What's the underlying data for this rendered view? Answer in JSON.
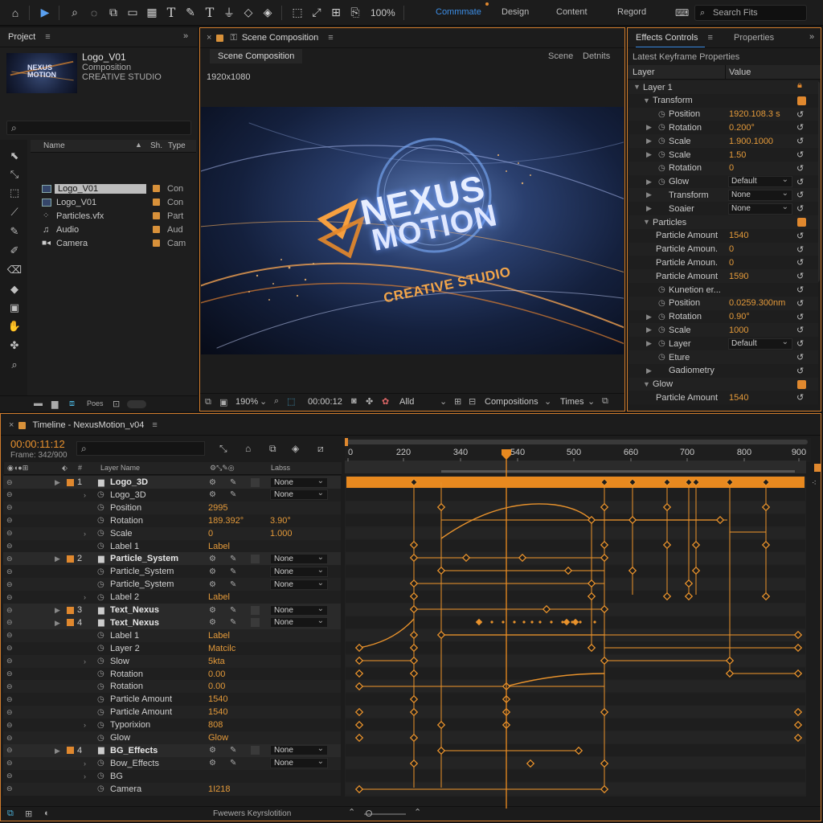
{
  "topbar": {
    "zoom": "100%",
    "workspaces": [
      "Commmate",
      "Design",
      "Content",
      "Regord"
    ],
    "search_placeholder": "Search Fits",
    "accent": "#3d8fe8"
  },
  "project": {
    "tab": "Project",
    "item_name": "Logo_V01",
    "item_type": "Composition",
    "item_studio": "CREATIVE STUDIO",
    "thumb_text": "NEXUS MOTION",
    "col_name": "Name",
    "col_sh": "Sh.",
    "col_type": "Type",
    "rows": [
      {
        "name": "Logo_V01",
        "type": "Con"
      },
      {
        "name": "Logo_V01",
        "type": "Con"
      },
      {
        "name": "Particles.vfx",
        "type": "Part"
      },
      {
        "name": "Audio",
        "type": "Aud"
      },
      {
        "name": "Camera",
        "type": "Cam"
      }
    ],
    "footer_label": "Poes"
  },
  "composition": {
    "tab": "Scene Composition",
    "subtab": "Scene Composition",
    "right_links": [
      "Scene",
      "Detnits"
    ],
    "resolution": "1920x1080",
    "logo_line1": "NEXUS",
    "logo_line2": "MOTION",
    "logo_tagline": "CREATIVE STUDIO",
    "footer": {
      "zoom": "190%",
      "timecode": "00:00:12",
      "mode": "Alld",
      "compositions": "Compositions",
      "times": "Times"
    }
  },
  "effects": {
    "tabs": [
      "Effects Controls",
      "Properties"
    ],
    "subtitle": "Latest Keyframe Properties",
    "col_layer": "Layer",
    "col_value": "Value",
    "rows": [
      {
        "label": "Layer 1",
        "level": 0,
        "kind": "group"
      },
      {
        "label": "Transform",
        "level": 1,
        "kind": "group"
      },
      {
        "label": "Position",
        "level": 2,
        "value": "1920.108.3 s"
      },
      {
        "label": "Rotation",
        "level": 2,
        "value": "0.200°",
        "tw": true
      },
      {
        "label": "Scale",
        "level": 2,
        "value": "1.900.1000",
        "tw": true
      },
      {
        "label": "Scale",
        "level": 2,
        "value": "1.50",
        "tw": true
      },
      {
        "label": "Rotation",
        "level": 2,
        "value": "0"
      },
      {
        "label": "Glow",
        "level": 2,
        "dropdown": "Default",
        "tw": true
      },
      {
        "label": "Transform",
        "level": 2,
        "dropdown": "None",
        "tw": true,
        "nosw": true
      },
      {
        "label": "Soaier",
        "level": 2,
        "dropdown": "None",
        "tw": true,
        "nosw": true
      },
      {
        "label": "Particles",
        "level": 1,
        "kind": "group"
      },
      {
        "label": "Particle Amount",
        "level": 3,
        "value": "1540"
      },
      {
        "label": "Particle Amoun.",
        "level": 3,
        "value": "0"
      },
      {
        "label": "Particle Amoun.",
        "level": 3,
        "value": "0"
      },
      {
        "label": "Particle Amount",
        "level": 3,
        "value": "1590"
      },
      {
        "label": "Kunetion er...",
        "level": 2,
        "value": ""
      },
      {
        "label": "Position",
        "level": 2,
        "value": "0.0259.300nm"
      },
      {
        "label": "Rotation",
        "level": 2,
        "value": "0.90°",
        "tw": true
      },
      {
        "label": "Scale",
        "level": 2,
        "value": "1000",
        "tw": true
      },
      {
        "label": "Layer",
        "level": 2,
        "dropdown": "Default",
        "tw": true
      },
      {
        "label": "Eture",
        "level": 2,
        "value": ""
      },
      {
        "label": "Gadiometry",
        "level": 2,
        "value": "",
        "tw": true,
        "nosw": true
      },
      {
        "label": "Glow",
        "level": 1,
        "kind": "group"
      },
      {
        "label": "Particle Amount",
        "level": 3,
        "value": "1540"
      }
    ]
  },
  "timeline": {
    "tab": "Timeline - NexusMotion_v04",
    "timecode": "00:00:11:12",
    "frame": "Frame: 342/900",
    "col_layer_name": "Layer Name",
    "col_labels": "Labss",
    "ruler": [
      "0",
      "220",
      "340",
      "540",
      "500",
      "660",
      "700",
      "800",
      "900"
    ],
    "footer_label": "Fwewers Keyrslotition",
    "rows": [
      {
        "indent": 0,
        "num": "1",
        "name": "Logo_3D",
        "bold": true,
        "layer": true,
        "dd": "None"
      },
      {
        "indent": 1,
        "name": "Logo_3D",
        "tw": true,
        "dd": "None",
        "icons": true
      },
      {
        "indent": 1,
        "name": "Position",
        "v1": "2995"
      },
      {
        "indent": 1,
        "name": "Rotation",
        "v1": "189.392°",
        "v2": "3.90°"
      },
      {
        "indent": 1,
        "name": "Scale",
        "tw": true,
        "v1": "0",
        "v2": "1.000"
      },
      {
        "indent": 1,
        "name": "Label 1",
        "v1": "Label"
      },
      {
        "indent": 0,
        "num": "2",
        "name": "Particle_System",
        "bold": true,
        "layer": true,
        "dd": "None"
      },
      {
        "indent": 1,
        "name": "Particle_System",
        "dd": "None",
        "icons": true
      },
      {
        "indent": 1,
        "name": "Particle_System",
        "dd": "None",
        "icons": true
      },
      {
        "indent": 1,
        "name": "Label 2",
        "tw": true,
        "v1": "Label"
      },
      {
        "indent": 0,
        "num": "3",
        "name": "Text_Nexus",
        "bold": true,
        "layer": true,
        "dd": "None"
      },
      {
        "indent": 0,
        "num": "4",
        "name": "Text_Nexus",
        "bold": true,
        "layer": true,
        "dd": "None"
      },
      {
        "indent": 1,
        "name": "Label 1",
        "v1": "Label"
      },
      {
        "indent": 1,
        "name": "Layer 2",
        "v1": "Matcilc"
      },
      {
        "indent": 1,
        "name": "Slow",
        "tw": true,
        "v1": "5kta"
      },
      {
        "indent": 1,
        "name": "Rotation",
        "v1": "0.00"
      },
      {
        "indent": 1,
        "name": "Rotation",
        "v1": "0.00"
      },
      {
        "indent": 1,
        "name": "Particle Amount",
        "v1": "1540"
      },
      {
        "indent": 1,
        "name": "Particle Amount",
        "v1": "1540"
      },
      {
        "indent": 1,
        "name": "Typorixion",
        "tw": true,
        "v1": "808"
      },
      {
        "indent": 1,
        "name": "Glow",
        "v1": "Glow"
      },
      {
        "indent": 0,
        "num": "4",
        "name": "BG_Effects",
        "bold": true,
        "layer": true,
        "dd": "None"
      },
      {
        "indent": 1,
        "name": "Bow_Effects",
        "tw": true,
        "dd": "None",
        "icons": true
      },
      {
        "indent": 1,
        "name": "BG",
        "tw": true
      },
      {
        "indent": 1,
        "name": "Camera",
        "v1": "1I218"
      }
    ]
  }
}
